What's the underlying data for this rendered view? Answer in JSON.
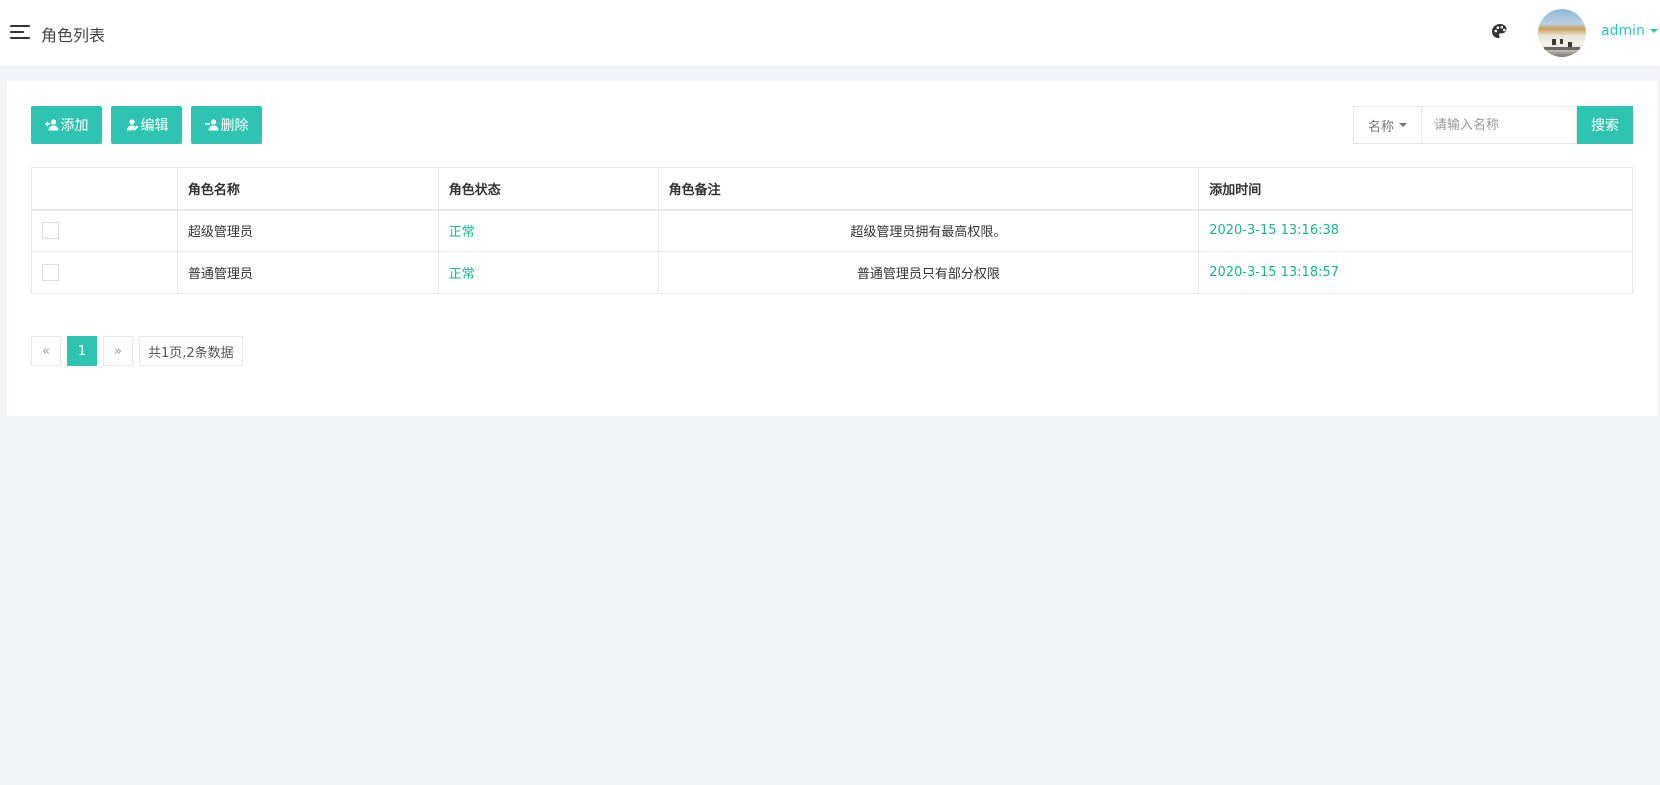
{
  "header": {
    "title": "角色列表",
    "user": "admin",
    "icons": {
      "menu": "hamburger-menu-icon",
      "theme": "palette-icon"
    }
  },
  "toolbar": {
    "add_label": "添加",
    "edit_label": "编辑",
    "delete_label": "删除"
  },
  "search": {
    "field_label": "名称",
    "placeholder": "请输入名称",
    "button_label": "搜索"
  },
  "table": {
    "columns": [
      "",
      "角色名称",
      "角色状态",
      "角色备注",
      "添加时间"
    ],
    "rows": [
      {
        "name": "超级管理员",
        "status": "正常",
        "remark": "超级管理员拥有最高权限。",
        "time": "2020-3-15 13:16:38"
      },
      {
        "name": "普通管理员",
        "status": "正常",
        "remark": "普通管理员只有部分权限",
        "time": "2020-3-15 13:18:57"
      }
    ]
  },
  "pagination": {
    "prev": "«",
    "current": "1",
    "next": "»",
    "summary": "共1页,2条数据"
  },
  "colors": {
    "accent": "#2fc4b2",
    "status_green": "#1ab394",
    "background": "#f3f4f8"
  }
}
